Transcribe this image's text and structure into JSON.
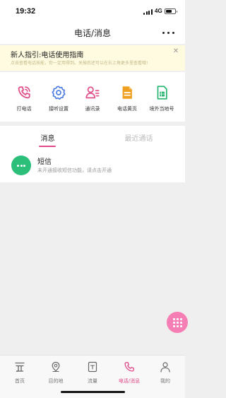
{
  "status_bar": {
    "time": "19:32",
    "network": "4G"
  },
  "nav": {
    "title": "电话/消息"
  },
  "guide": {
    "title": "新人指引:电话使用指南",
    "description": "点击查看电话技能，你一定用得到。关掉后还可以在右上角更多里查看哦!"
  },
  "functions": [
    {
      "label": "打电话",
      "icon": "phone-icon",
      "color": "#e0508a"
    },
    {
      "label": "接听设置",
      "icon": "gear-icon",
      "color": "#4a7be0"
    },
    {
      "label": "通讯录",
      "icon": "contacts-icon",
      "color": "#e0508a"
    },
    {
      "label": "电话黄页",
      "icon": "yellow-pages-icon",
      "color": "#f0a020"
    },
    {
      "label": "境外当地号",
      "icon": "sim-card-icon",
      "color": "#2bb673"
    }
  ],
  "tabs": [
    {
      "label": "消息",
      "active": true
    },
    {
      "label": "最近通话",
      "active": false
    }
  ],
  "sms": {
    "title": "短信",
    "description": "未开通接收短信功能，请点击开通",
    "icon_color": "#2bbf7a"
  },
  "bottom_tabs": [
    {
      "label": "首页",
      "icon": "home-icon",
      "active": false
    },
    {
      "label": "目的地",
      "icon": "location-pin-icon",
      "active": false
    },
    {
      "label": "流量",
      "icon": "data-plan-icon",
      "active": false
    },
    {
      "label": "电话/消息",
      "icon": "phone-icon",
      "active": true
    },
    {
      "label": "我的",
      "icon": "user-icon",
      "active": false
    }
  ],
  "colors": {
    "accent": "#e14a8a",
    "fab": "#f57fb5",
    "banner_bg": "#fffbe0"
  }
}
